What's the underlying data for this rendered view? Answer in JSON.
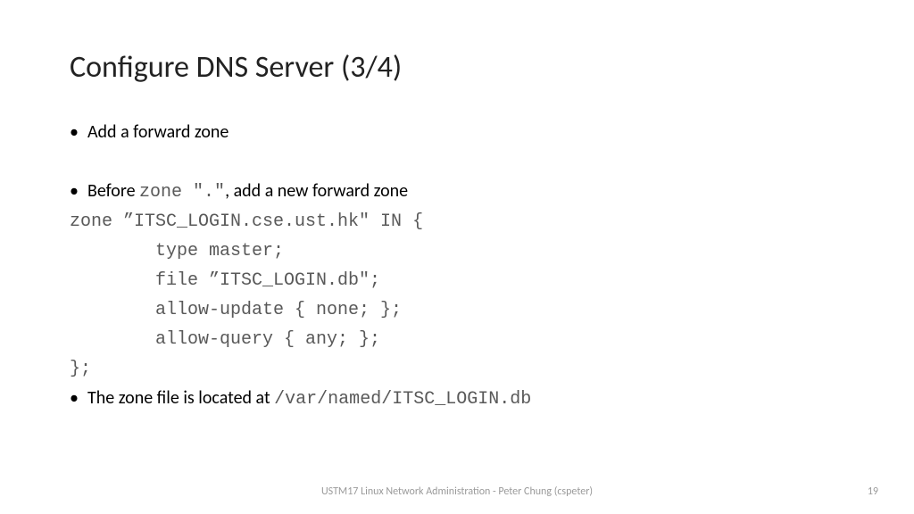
{
  "title": "Configure DNS Server (3/4)",
  "bullets": {
    "b1": "Add a forward zone",
    "b2_before": "Before ",
    "b2_code": "zone \".\"",
    "b2_after": ", add a new forward zone",
    "b3_before": "The zone file is located at ",
    "b3_code": "/var/named/ITSC_LOGIN.db"
  },
  "code": "zone ”ITSC_LOGIN.cse.ust.hk\" IN {\n        type master;\n        file ”ITSC_LOGIN.db\";\n        allow-update { none; };\n        allow-query { any; };\n};",
  "footer": "USTM17 Linux Network Administration - Peter Chung (cspeter)",
  "page_number": "19",
  "bullet_char": "•"
}
